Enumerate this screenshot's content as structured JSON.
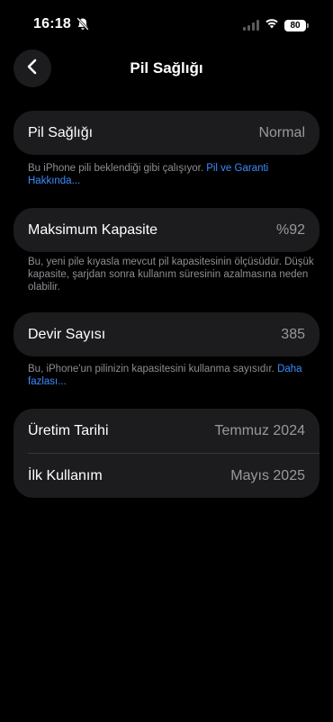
{
  "status_bar": {
    "time": "16:18",
    "battery_level": "80",
    "bell_icon": "bell-slash-icon",
    "wifi_icon": "wifi-icon",
    "cellular_icon": "cellular-signal-icon"
  },
  "nav": {
    "title": "Pil Sağlığı",
    "back_icon": "chevron-left-icon"
  },
  "battery_health": {
    "label": "Pil Sağlığı",
    "value": "Normal",
    "note": "Bu iPhone pili beklendiği gibi çalışıyor. ",
    "note_link": "Pil ve Garanti Hakkında..."
  },
  "max_capacity": {
    "label": "Maksimum Kapasite",
    "value": "%92",
    "note": "Bu, yeni pile kıyasla mevcut pil kapasitesinin ölçüsüdür. Düşük kapasite, şarjdan sonra kullanım süresinin azalmasına neden olabilir."
  },
  "cycle_count": {
    "label": "Devir Sayısı",
    "value": "385",
    "note": "Bu, iPhone'un pilinizin kapasitesini kullanma sayısıdır. ",
    "note_link": "Daha fazlası..."
  },
  "dates": {
    "manufacture_label": "Üretim Tarihi",
    "manufacture_value": "Temmuz 2024",
    "first_use_label": "İlk Kullanım",
    "first_use_value": "Mayıs 2025"
  },
  "colors": {
    "background": "#000000",
    "card": "#1c1c1e",
    "secondary_text": "#98989f",
    "link": "#3d8bfd"
  }
}
